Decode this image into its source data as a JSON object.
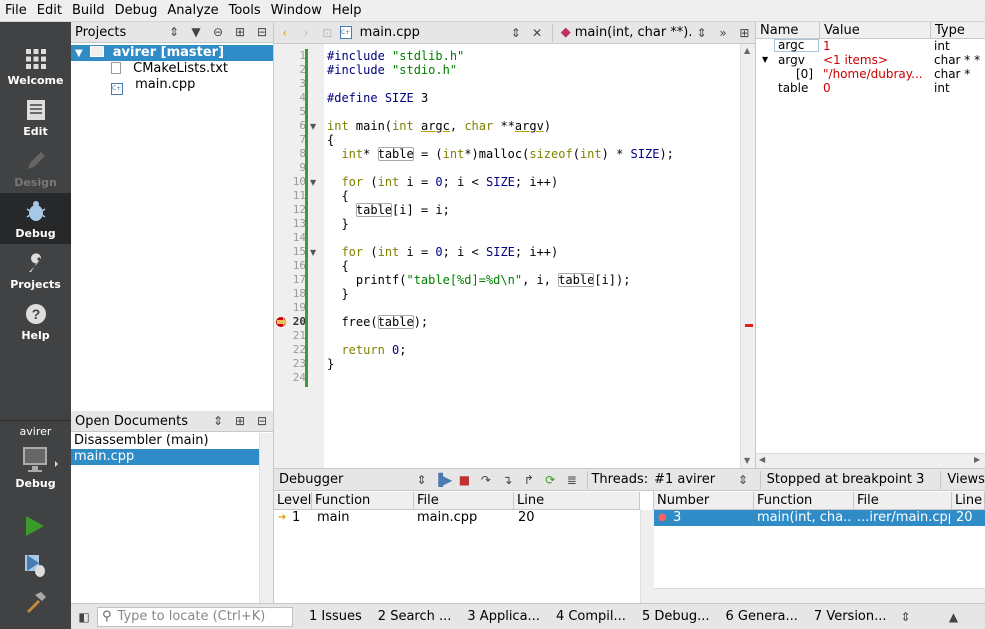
{
  "menubar": {
    "items": [
      "File",
      "Edit",
      "Build",
      "Debug",
      "Analyze",
      "Tools",
      "Window",
      "Help"
    ]
  },
  "modes": {
    "welcome": "Welcome",
    "edit": "Edit",
    "design": "Design",
    "debug": "Debug",
    "projects": "Projects",
    "help": "Help"
  },
  "kit": {
    "project": "avirer",
    "mode": "Debug"
  },
  "projects_panel": {
    "title": "Projects",
    "root": "avirer [master]",
    "files": [
      "CMakeLists.txt",
      "main.cpp"
    ]
  },
  "open_documents": {
    "title": "Open Documents",
    "items": [
      "Disassembler (main)",
      "main.cpp"
    ]
  },
  "editor": {
    "file": "main.cpp",
    "symbol": "main(int, char **)...",
    "current_line": 20
  },
  "locals": {
    "headers": [
      "Name",
      "Value",
      "Type"
    ],
    "rows": [
      {
        "name": "argc",
        "value": "1",
        "type": "int"
      },
      {
        "name": "argv",
        "value": "<1 items>",
        "type": "char * *"
      },
      {
        "name": "[0]",
        "value": "\"/home/dubray...",
        "type": "char *"
      },
      {
        "name": "table",
        "value": "0",
        "type": "int"
      }
    ]
  },
  "debugger_bar": {
    "label": "Debugger",
    "threads_label": "Threads:",
    "thread": "#1 avirer",
    "status": "Stopped at breakpoint 3",
    "views": "Views"
  },
  "stack": {
    "headers": [
      "Level",
      "Function",
      "File",
      "Line"
    ],
    "row": {
      "level": "1",
      "function": "main",
      "file": "main.cpp",
      "line": "20"
    }
  },
  "breakpoints": {
    "headers": [
      "Number",
      "Function",
      "File",
      "Line"
    ],
    "row": {
      "number": "3",
      "function": "main(int, cha...",
      "file": "...irer/main.cpp",
      "line": "20"
    }
  },
  "statusbar": {
    "locate_placeholder": "Type to locate (Ctrl+K)",
    "tabs": [
      "1  Issues",
      "2  Search ...",
      "3  Applica...",
      "4  Compil...",
      "5  Debug...",
      "6  Genera...",
      "7  Version..."
    ]
  },
  "colors": {
    "selection": "#308cc6",
    "modebar": "#404244",
    "breakpoint": "#cc0000",
    "run": "#3a9a2a"
  }
}
